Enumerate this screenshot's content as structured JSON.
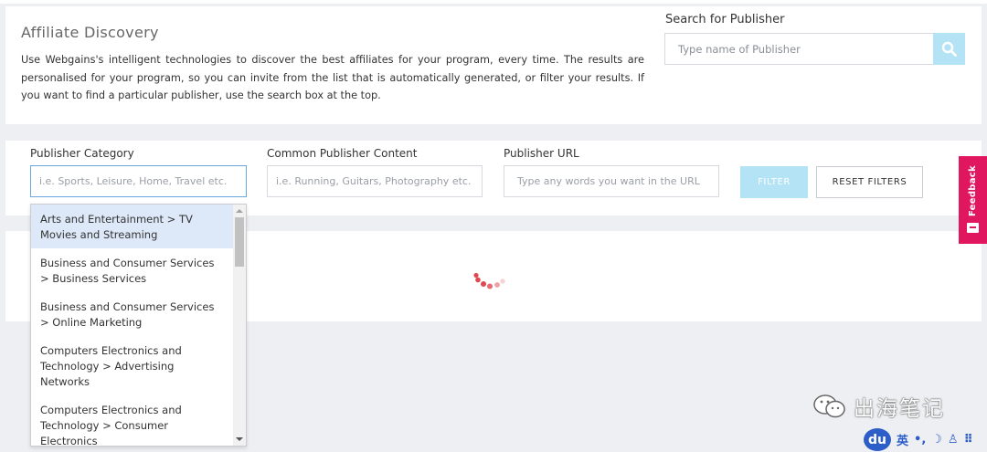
{
  "intro": {
    "title": "Affiliate Discovery",
    "description": "Use Webgains's intelligent technologies to discover the best affiliates for your program, every time. The results are personalised for your program, so you can invite from the list that is automatically generated, or filter your results. If you want to find a particular publisher, use the search box at the top."
  },
  "search": {
    "label": "Search for Publisher",
    "placeholder": "Type name of Publisher",
    "button_icon": "search-icon"
  },
  "filters": {
    "category": {
      "label": "Publisher Category",
      "placeholder": "i.e. Sports, Leisure, Home, Travel etc."
    },
    "content": {
      "label": "Common Publisher Content",
      "placeholder": "i.e. Running, Guitars, Photography etc."
    },
    "url": {
      "label": "Publisher URL",
      "placeholder": "Type any words you want in the URL"
    },
    "filter_button": "FILTER",
    "reset_button": "RESET FILTERS"
  },
  "category_dropdown": {
    "items": [
      "Arts and Entertainment > TV Movies and Streaming",
      "Business and Consumer Services > Business Services",
      "Business and Consumer Services > Online Marketing",
      "Computers Electronics and Technology > Advertising Networks",
      "Computers Electronics and Technology > Consumer Electronics"
    ],
    "highlighted_index": 0
  },
  "feedback": {
    "label": "Feedback"
  },
  "watermark": {
    "text": "出海笔记"
  },
  "ime": {
    "logo": "du",
    "mode": "英",
    "punct": "•,",
    "moon": "☽",
    "user": "♙",
    "grid": "⠿"
  },
  "colors": {
    "accent_light": "#b3e3f5",
    "feedback": "#e0175f",
    "highlight": "#dde8f8",
    "spinner": "#e0484f"
  }
}
